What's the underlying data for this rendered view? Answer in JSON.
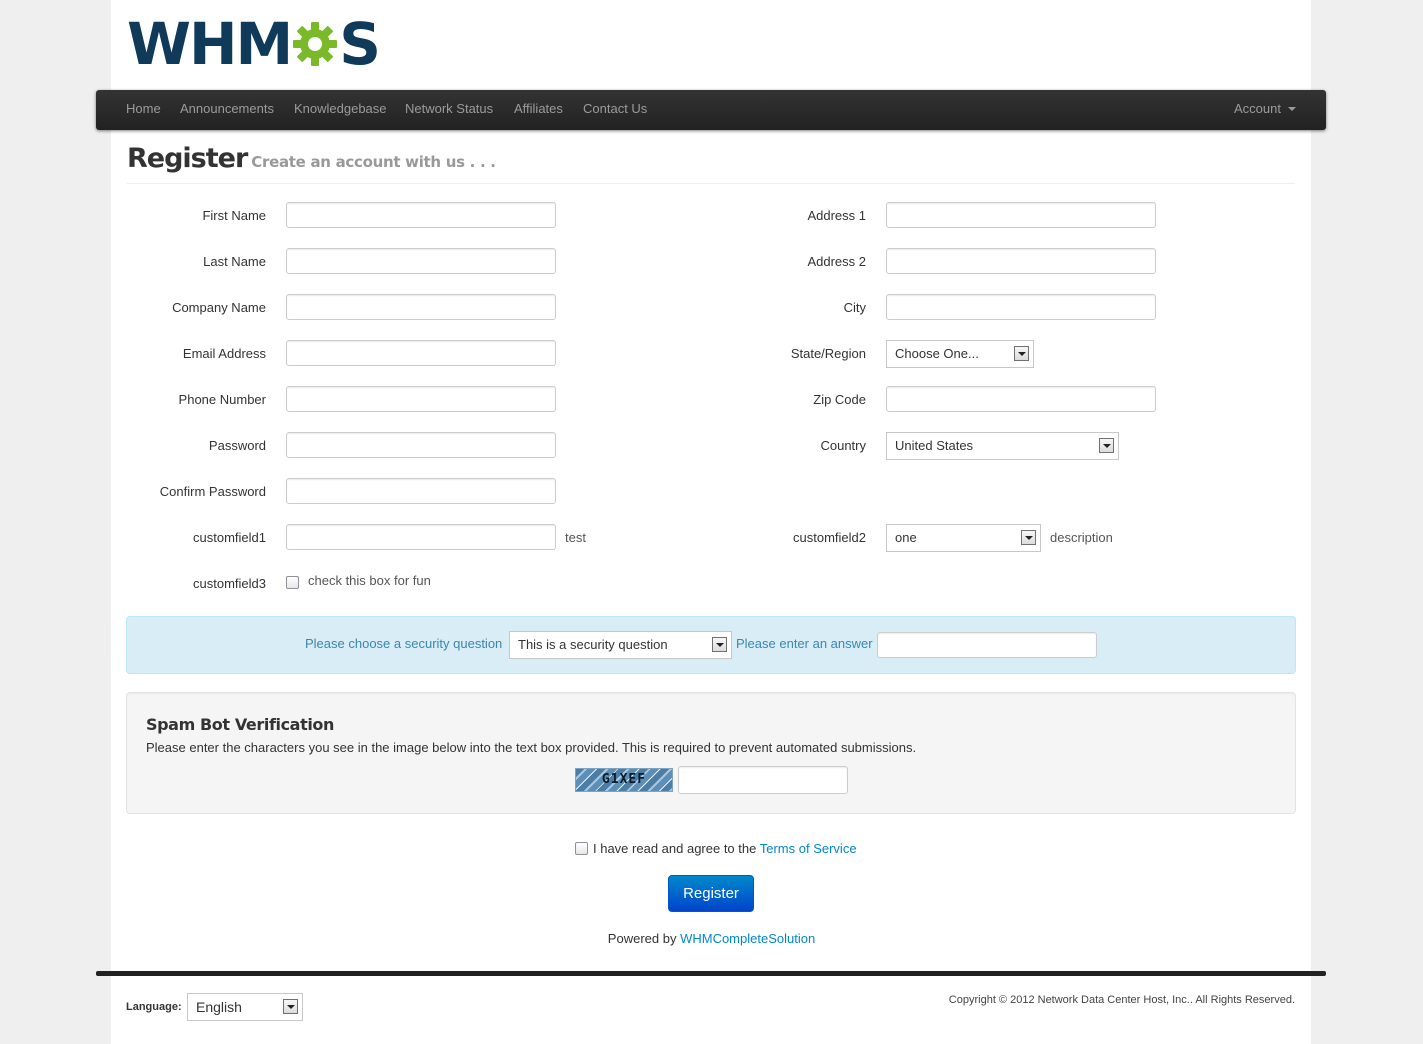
{
  "nav": {
    "items": [
      "Home",
      "Announcements",
      "Knowledgebase",
      "Network Status",
      "Affiliates",
      "Contact Us"
    ],
    "account": "Account"
  },
  "heading": {
    "title": "Register",
    "subtitle": "Create an account with us . . ."
  },
  "form": {
    "left": {
      "first_name": "First Name",
      "last_name": "Last Name",
      "company_name": "Company Name",
      "email": "Email Address",
      "phone": "Phone Number",
      "password": "Password",
      "confirm_password": "Confirm Password",
      "customfield1": "customfield1",
      "customfield1_note": "test",
      "customfield3": "customfield3",
      "customfield3_note": "check this box for fun"
    },
    "right": {
      "address1": "Address 1",
      "address2": "Address 2",
      "city": "City",
      "state": "State/Region",
      "state_value": "Choose One...",
      "zip": "Zip Code",
      "country": "Country",
      "country_value": "United States",
      "customfield2": "customfield2",
      "customfield2_value": "one",
      "customfield2_note": "description"
    }
  },
  "security": {
    "question_label": "Please choose a security question",
    "question_value": "This is a security question",
    "answer_label": "Please enter an answer"
  },
  "spam": {
    "title": "Spam Bot Verification",
    "description": "Please enter the characters you see in the image below into the text box provided. This is required to prevent automated submissions.",
    "captcha_text": "G1XEF"
  },
  "tos": {
    "text": "I have read and agree to the",
    "link": "Terms of Service"
  },
  "register_button": "Register",
  "powered": {
    "text": "Powered by",
    "link": "WHMCompleteSolution"
  },
  "footer": {
    "language_label": "Language:",
    "language_value": "English",
    "copyright": "Copyright © 2012 Network Data Center Host, Inc.. All Rights Reserved."
  },
  "colors": {
    "logo_text": "#0f3a5a",
    "logo_gear": "#7ab929",
    "link": "#0088cc",
    "info_box": "#d9edf7",
    "button": "#0066cc"
  }
}
